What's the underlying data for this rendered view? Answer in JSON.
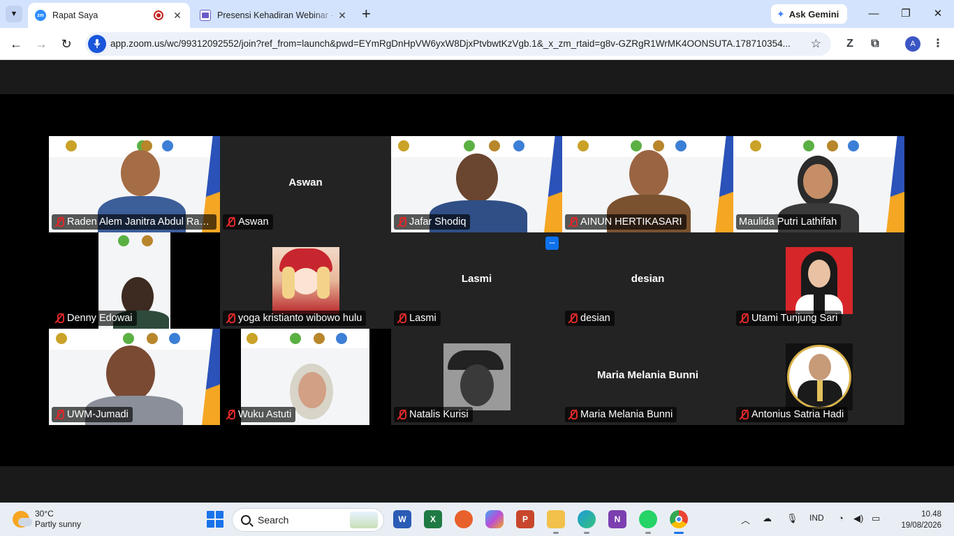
{
  "browser": {
    "tabs": [
      {
        "label": "Rapat Saya",
        "active": true,
        "favicon": "zoom-icon"
      },
      {
        "label": "Presensi Kehadiran Webinar - B",
        "active": false,
        "favicon": "forms-icon"
      }
    ],
    "ask_gemini": "Ask Gemini",
    "url": "app.zoom.us/wc/99312092552/join?ref_from=launch&pwd=EYmRgDnHpVW6yxW8DjxPtvbwtKzVgb.1&_x_zm_rtaid=g8v-GZRgR1WrMK4OONSUTA.178710354...",
    "profile_initial": "A"
  },
  "meeting": {
    "more_button": "...",
    "participants": [
      {
        "name": "Raden Alem Janitra Abdul Rah...",
        "type": "video",
        "muted": true
      },
      {
        "name": "Aswan",
        "type": "name-only",
        "muted": true
      },
      {
        "name": "Jafar Shodiq",
        "type": "video",
        "muted": true
      },
      {
        "name": "AINUN HERTIKASARI",
        "type": "video",
        "muted": true
      },
      {
        "name": "Maulida Putri Lathifah",
        "type": "video",
        "muted": false,
        "active_speaker": true
      },
      {
        "name": "Denny Edowai",
        "type": "video",
        "muted": true
      },
      {
        "name": "yoga kristianto wibowo hulu",
        "type": "avatar",
        "muted": true
      },
      {
        "name": "Lasmi",
        "type": "name-only",
        "muted": true
      },
      {
        "name": "desian",
        "type": "name-only",
        "muted": true
      },
      {
        "name": "Utami Tunjung Sari",
        "type": "avatar",
        "muted": true
      },
      {
        "name": "UWM-Jumadi",
        "type": "video",
        "muted": true
      },
      {
        "name": "Wuku Astuti",
        "type": "video",
        "muted": true
      },
      {
        "name": "Natalis Kurisi",
        "type": "avatar",
        "muted": true
      },
      {
        "name": "Maria Melania Bunni",
        "type": "name-only",
        "muted": true
      },
      {
        "name": "Antonius Satria Hadi",
        "type": "avatar",
        "muted": true
      }
    ]
  },
  "taskbar": {
    "weather_temp": "30°C",
    "weather_desc": "Partly sunny",
    "search_label": "Search",
    "language": "IND",
    "time": "10.48",
    "date": "19/08/2026",
    "apps": [
      "word-icon",
      "excel-icon",
      "firefox-icon",
      "copilot-icon",
      "powerpoint-icon",
      "file-explorer-icon",
      "edge-icon",
      "onenote-icon",
      "whatsapp-icon",
      "chrome-icon"
    ]
  },
  "colors": {
    "active_speaker": "#23d959",
    "muted_icon": "#e02828",
    "zoom_blue": "#0e71eb"
  }
}
